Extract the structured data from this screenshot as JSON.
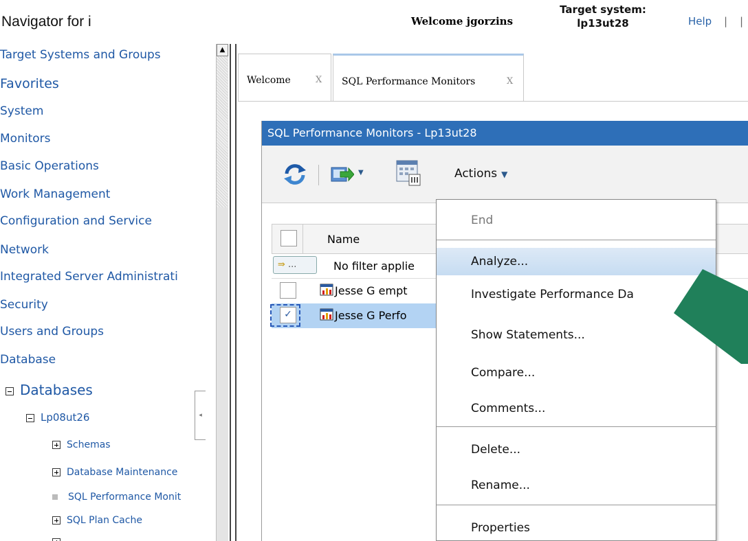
{
  "header": {
    "app_title": "Navigator for i",
    "welcome": "Welcome jgorzins",
    "target_label": "Target system:",
    "target_value": "lp13ut28",
    "help": "Help",
    "separator": "|"
  },
  "sidebar": {
    "items": [
      "Target Systems and Groups",
      "Favorites",
      "System",
      "Monitors",
      "Basic Operations",
      "Work Management",
      "Configuration and Service",
      "Network",
      "Integrated Server Administrati",
      "Security",
      "Users and Groups",
      "Database"
    ],
    "tree": {
      "databases": "Databases",
      "system_db": "Lp08ut26",
      "children": [
        "Schemas",
        "Database Maintenance",
        "SQL Performance Monit",
        "SQL Plan Cache"
      ]
    }
  },
  "tabs": [
    {
      "label": "Welcome",
      "close": "X"
    },
    {
      "label": "SQL Performance Monitors",
      "close": "X"
    }
  ],
  "panel": {
    "title": "SQL Performance Monitors - Lp13ut28",
    "toolbar": {
      "actions": "Actions",
      "dropdown_arrow": "▼"
    },
    "table": {
      "column_name": "Name",
      "filter_button": "...",
      "filter_text": "No filter applie",
      "rows": [
        {
          "name": "Jesse G empt",
          "checked": false
        },
        {
          "name": "Jesse G Perfo",
          "checked": true
        }
      ]
    }
  },
  "context_menu": {
    "items": [
      "End",
      "Analyze...",
      "Investigate Performance Da",
      "Show Statements...",
      "Compare...",
      "Comments...",
      "Delete...",
      "Rename...",
      "Properties"
    ]
  },
  "colors": {
    "title_bar": "#2e6fb8",
    "link": "#1f58a5",
    "selection": "#b3d3f3",
    "arrow": "#20805a"
  }
}
